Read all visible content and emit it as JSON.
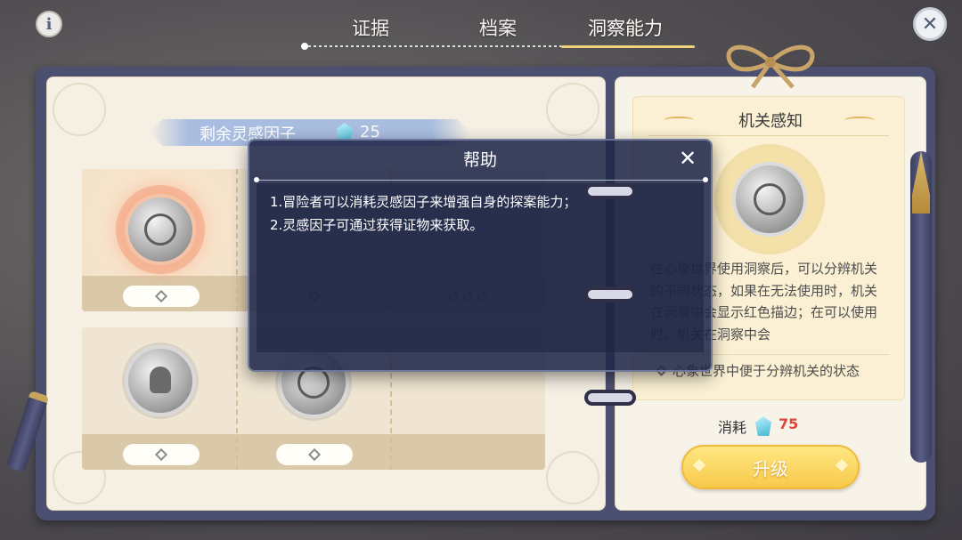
{
  "top_bar": {
    "info_icon": "i",
    "tabs": [
      {
        "label": "证据",
        "active": false
      },
      {
        "label": "档案",
        "active": false
      },
      {
        "label": "洞察能力",
        "active": true
      }
    ],
    "close_icon": "✕"
  },
  "left_page": {
    "remaining_label": "剩余灵感因子",
    "remaining_count": "25",
    "cost_marks": {
      "row1": [
        "◇",
        "◇",
        "◇ ◇ ◇"
      ],
      "row2": [
        "◇",
        "◇"
      ]
    }
  },
  "right_page": {
    "title": "机关感知",
    "description": "在心象世界使用洞察后，可以分辨机关的不同状态，如果在无法使用时，机关在洞察中会显示红色描边；在可以使用时，机关在洞察中会",
    "effect": "心象世界中便于分辨机关的状态",
    "cost_label": "消耗",
    "cost_value": "75",
    "upgrade_label": "升级"
  },
  "help_modal": {
    "title": "帮助",
    "close_icon": "✕",
    "lines": [
      "1.冒险者可以消耗灵感因子来增强自身的探案能力；",
      "2.灵感因子可通过获得证物来获取。"
    ]
  },
  "colors": {
    "book_frame": "#4c5070",
    "tab_underline": "#f1d27c",
    "cost_value": "#e0433c",
    "upgrade_button": "#f7c94a",
    "modal_bg": "#20284a"
  }
}
